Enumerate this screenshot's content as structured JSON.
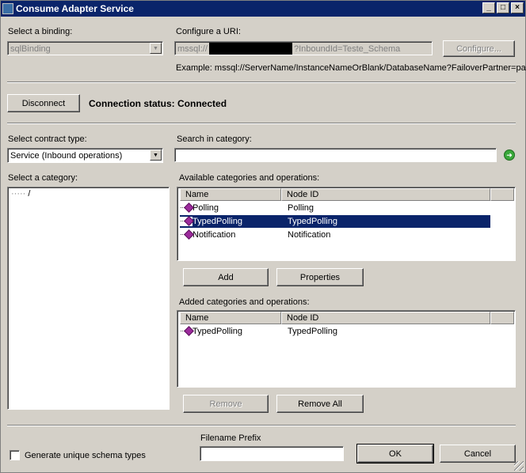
{
  "window": {
    "title": "Consume Adapter Service",
    "buttons": [
      "_",
      "□",
      "×"
    ]
  },
  "binding": {
    "label": "Select a binding:",
    "value": "sqlBinding"
  },
  "uri": {
    "label": "Configure a URI:",
    "prefix": "mssql://",
    "suffix": "?InboundId=Teste_Schema",
    "configure_label": "Configure...",
    "example": "Example: mssql://ServerName/InstanceNameOrBlank/DatabaseName?FailoverPartner=pa"
  },
  "connection": {
    "disconnect_label": "Disconnect",
    "status_label": "Connection status:",
    "status_value": "Connected"
  },
  "contract": {
    "label": "Select contract type:",
    "value": "Service (Inbound operations)"
  },
  "search": {
    "label": "Search in category:",
    "value": ""
  },
  "category": {
    "label": "Select a category:",
    "tree_root": "/"
  },
  "available": {
    "label": "Available categories and operations:",
    "columns": [
      "Name",
      "Node ID"
    ],
    "rows": [
      {
        "name": "Polling",
        "node_id": "Polling"
      },
      {
        "name": "TypedPolling",
        "node_id": "TypedPolling"
      },
      {
        "name": "Notification",
        "node_id": "Notification"
      }
    ],
    "add_label": "Add",
    "properties_label": "Properties"
  },
  "added": {
    "label": "Added categories and operations:",
    "columns": [
      "Name",
      "Node ID"
    ],
    "rows": [
      {
        "name": "TypedPolling",
        "node_id": "TypedPolling"
      }
    ],
    "remove_label": "Remove",
    "remove_all_label": "Remove All"
  },
  "footer": {
    "unique_label": "Generate unique schema types",
    "prefix_label": "Filename Prefix",
    "prefix_value": "",
    "ok_label": "OK",
    "cancel_label": "Cancel"
  },
  "colors": {
    "titlebar": "#0a246a",
    "selection": "#0a246a",
    "face": "#d4d0c8"
  }
}
